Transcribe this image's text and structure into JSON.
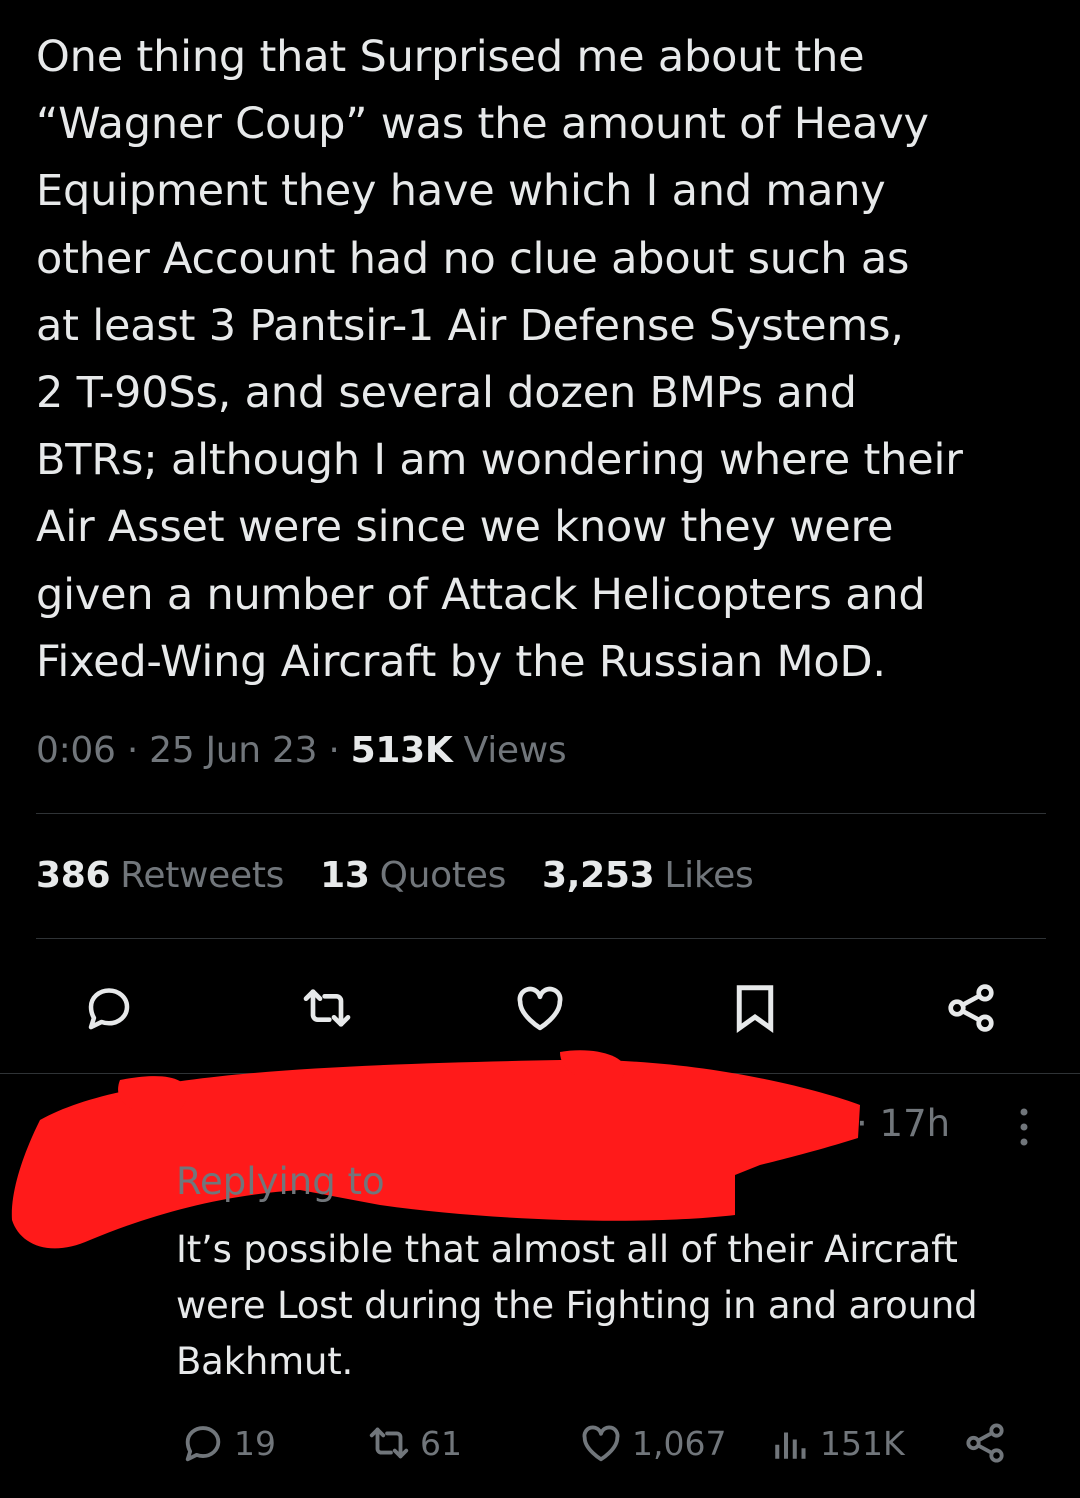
{
  "tweet": {
    "text": "One thing that Surprised me about the\n“Wagner Coup” was the amount of Heavy\nEquipment they have which I and many\nother Account had no clue about such as\nat least 3 Pantsir-1 Air Defense Systems,\n2 T-90Ss, and several dozen BMPs and\nBTRs; although I am wondering where their\nAir Asset were since we know they were\ngiven a number of Attack Helicopters and\nFixed-Wing Aircraft by the Russian MoD.",
    "time": "0:06",
    "sep": "·",
    "date": "25 Jun 23",
    "views_count": "513K",
    "views_label": "Views"
  },
  "stats": {
    "retweets_count": "386",
    "retweets_label": "Retweets",
    "quotes_count": "13",
    "quotes_label": "Quotes",
    "likes_count": "3,253",
    "likes_label": "Likes"
  },
  "actions": [
    "reply-icon",
    "retweet-icon",
    "like-icon",
    "bookmark-icon",
    "share-icon"
  ],
  "reply": {
    "time": "· 17h",
    "replying_to": "Replying to",
    "text": "It’s possible that almost all of their Aircraft\nwere Lost during the Fighting in and around\nBakhmut.",
    "reply_count": "19",
    "retweet_count": "61",
    "like_count": "1,067",
    "views_count": "151K"
  },
  "colors": {
    "background": "#000000",
    "text": "#e7e9ea",
    "secondary": "#71767b",
    "divider": "#2f3336",
    "redaction": "#ff1a1a"
  }
}
